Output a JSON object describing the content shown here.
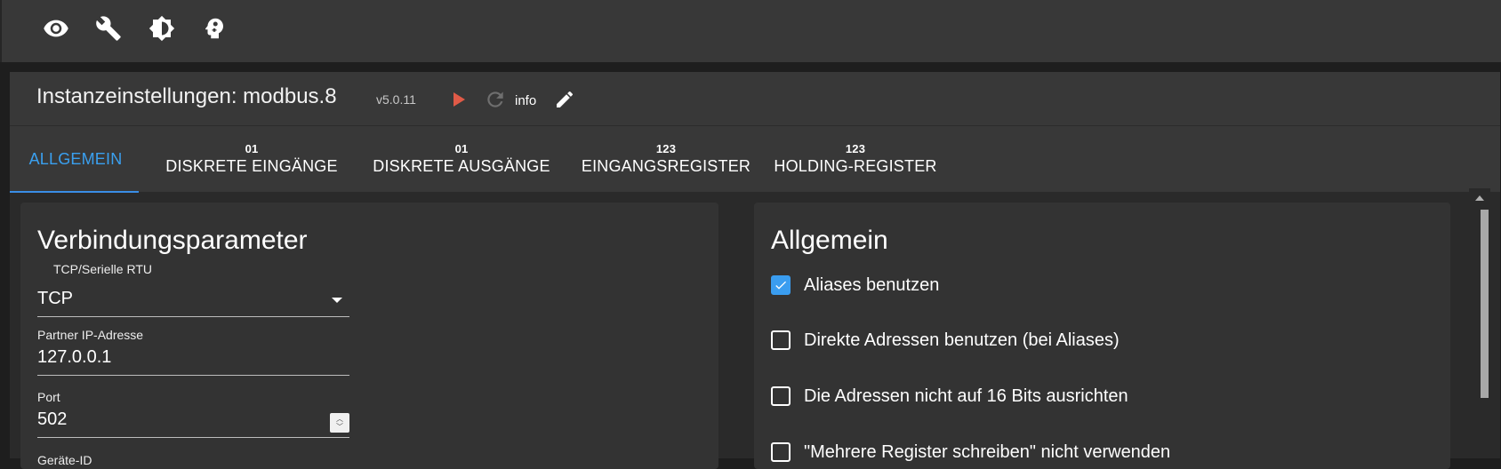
{
  "toolbar": {
    "icons": [
      "eye-icon",
      "wrench-icon",
      "brightness-icon",
      "expert-mode-icon"
    ]
  },
  "header": {
    "title": "Instanzeinstellungen: modbus.8",
    "version": "v5.0.11",
    "info_label": "info"
  },
  "tabs": [
    {
      "label": "ALLGEMEIN",
      "sub": "",
      "active": true
    },
    {
      "label": "DISKRETE EINGÄNGE",
      "sub": "01"
    },
    {
      "label": "DISKRETE AUSGÄNGE",
      "sub": "01"
    },
    {
      "label": "EINGANGSREGISTER",
      "sub": "123"
    },
    {
      "label": "HOLDING-REGISTER",
      "sub": "123"
    }
  ],
  "left_card": {
    "title": "Verbindungsparameter",
    "type_label": "TCP/Serielle RTU",
    "type_value": "TCP",
    "ip_label": "Partner IP-Adresse",
    "ip_value": "127.0.0.1",
    "port_label": "Port",
    "port_value": "502",
    "device_id_label": "Geräte-ID"
  },
  "right_card": {
    "title": "Allgemein",
    "options": [
      {
        "label": "Aliases benutzen",
        "checked": true
      },
      {
        "label": "Direkte Adressen benutzen (bei Aliases)",
        "checked": false
      },
      {
        "label": "Die Adressen nicht auf 16 Bits ausrichten",
        "checked": false
      },
      {
        "label": "\"Mehrere Register schreiben\" nicht verwenden",
        "checked": false
      }
    ]
  },
  "colors": {
    "accent": "#3aa0f0",
    "play": "#e05a47",
    "background": "#2a2a2a",
    "header": "#383838"
  }
}
